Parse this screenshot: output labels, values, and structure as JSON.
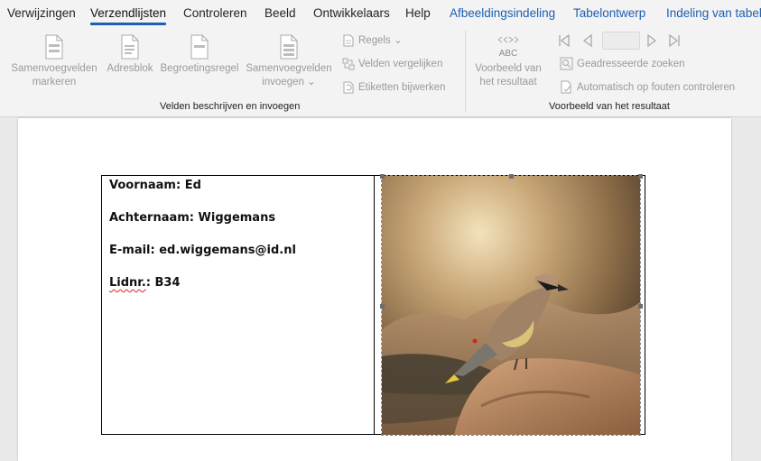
{
  "ribbon_tabs": {
    "t0": "Verwijzingen",
    "t1": "Verzendlijsten",
    "t2": "Controleren",
    "t3": "Beeld",
    "t4": "Ontwikkelaars",
    "t5": "Help",
    "t6": "Afbeeldingsindeling",
    "t7": "Tabelontwerp",
    "t8": "Indeling van tabel",
    "active": "Verzendlijsten"
  },
  "group_fields": {
    "highlight_line1": "Samenvoegvelden",
    "highlight_line2": "markeren",
    "address_block": "Adresblok",
    "greeting_line": "Begroetingsregel",
    "insert_line1": "Samenvoegvelden",
    "insert_line2": "invoegen ⌄",
    "rules": "Regels ⌄",
    "match_fields": "Velden vergelijken",
    "update_labels": "Etiketten bijwerken",
    "group_label": "Velden beschrijven en invoegen"
  },
  "group_preview": {
    "preview_icon_text": "ABC",
    "preview_line1": "Voorbeeld van",
    "preview_line2": "het resultaat",
    "record_value": "",
    "find_recipient": "Geadresseerde zoeken",
    "check_errors": "Automatisch op fouten controleren",
    "group_label": "Voorbeeld van het resultaat"
  },
  "document": {
    "first_name": "Voornaam: Ed",
    "last_name": "Achternaam: Wiggemans",
    "email": "E-mail: ed.wiggemans@id.nl",
    "member_label": "Lidnr.",
    "member_value": ": B34"
  },
  "colors": {
    "accent": "#1d5fb3",
    "disabled_text": "#9a9a9a",
    "spellcheck_underline": "#dd2222"
  }
}
